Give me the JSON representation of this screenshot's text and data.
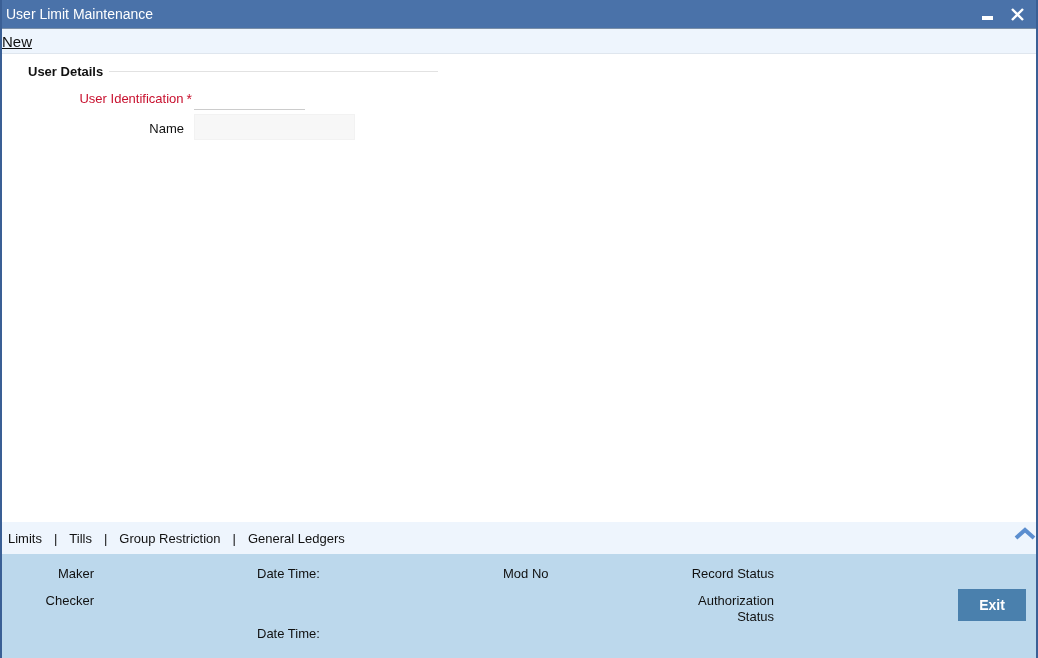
{
  "window": {
    "title": "User Limit Maintenance"
  },
  "toolbar": {
    "actions": [
      "New"
    ]
  },
  "section": {
    "title": "User Details",
    "fields": [
      {
        "label": "User Identification",
        "required": true,
        "required_mark": "*",
        "kind": "underline"
      },
      {
        "label": "Name",
        "required": false,
        "kind": "box"
      }
    ]
  },
  "tabs": [
    {
      "label": "Limits"
    },
    {
      "label": "Tills"
    },
    {
      "label": "Group Restriction"
    },
    {
      "label": "General Ledgers"
    }
  ],
  "tab_separator": "|",
  "audit": {
    "maker": "Maker",
    "checker": "Checker",
    "maker_date_time": "Date Time:",
    "checker_date_time": "Date Time:",
    "mod_no": "Mod No",
    "record_status": "Record Status",
    "authorization_status": [
      "Authorization",
      "Status"
    ]
  },
  "buttons": [
    "Exit"
  ]
}
